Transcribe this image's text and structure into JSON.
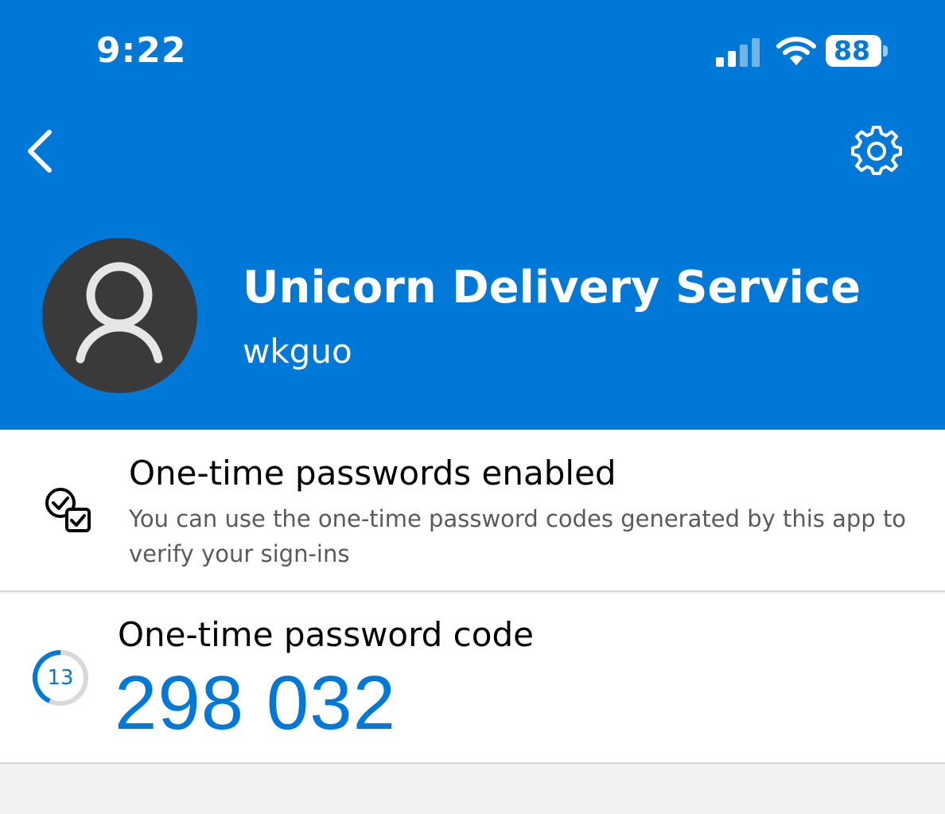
{
  "status_bar": {
    "time": "9:22",
    "battery": "88",
    "signal_icon": "cellular-signal-icon",
    "wifi_icon": "wifi-icon",
    "battery_icon": "battery-icon"
  },
  "nav": {
    "back_icon": "chevron-left-icon",
    "settings_icon": "gear-icon"
  },
  "account": {
    "name": "Unicorn Delivery Service",
    "username": "wkguo",
    "avatar_icon": "person-icon"
  },
  "otp_enabled": {
    "icon": "checkbox-stack-icon",
    "title": "One-time passwords enabled",
    "description": "You can use the one-time password codes generated by this app to verify your sign-ins"
  },
  "otp_code": {
    "label": "One-time password code",
    "code": "298 032",
    "seconds_remaining": "13",
    "timer_fraction": 0.43
  },
  "colors": {
    "brand": "#0078d7",
    "avatar_bg": "#3a3a3a",
    "page_bg": "#f2f2f2"
  }
}
